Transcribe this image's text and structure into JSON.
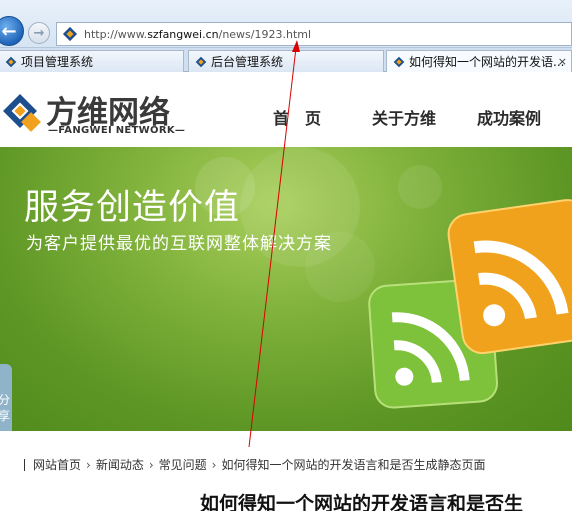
{
  "browser": {
    "url_prefix": "http://www.",
    "url_domain": "szfangwei.cn",
    "url_path": "/news/1923.html",
    "tabs": [
      {
        "label": "项目管理系统",
        "active": false
      },
      {
        "label": "后台管理系统",
        "active": false
      },
      {
        "label": "如何得知一个网站的开发语...",
        "active": true
      }
    ],
    "tab_close": "×"
  },
  "site": {
    "logo_title": "方维网络",
    "logo_sub": "—FANGWEI NETWORK—",
    "nav": [
      "首　页",
      "关于方维",
      "成功案例"
    ]
  },
  "banner": {
    "title": "服务创造价值",
    "subtitle": "为客户提供最优的互联网整体解决方案",
    "share_label": [
      "分",
      "享"
    ]
  },
  "breadcrumb": {
    "items": [
      "网站首页",
      "新闻动态",
      "常见问题",
      "如何得知一个网站的开发语言和是否生成静态页面"
    ],
    "separator": "›"
  },
  "article": {
    "title": "如何得知一个网站的开发语言和是否生"
  },
  "colors": {
    "banner_green": "#6aa22c",
    "rss_green": "#7dc23a",
    "rss_orange": "#f0a21c",
    "annotation_red": "#d80000"
  }
}
